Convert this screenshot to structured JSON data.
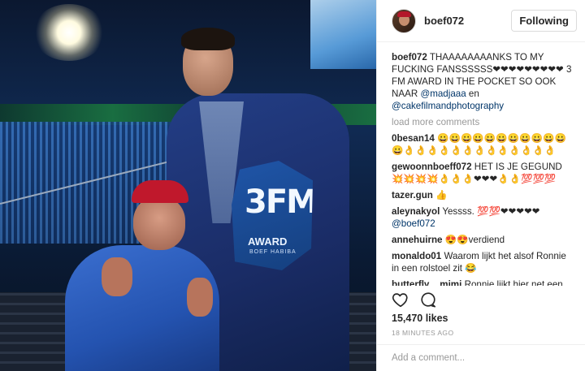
{
  "post": {
    "image_alt": "",
    "award": {
      "logo": "3FM",
      "word": "AWARD",
      "sub": "BOEF HABIBA"
    }
  },
  "header": {
    "username": "boef072",
    "follow_label": "Following"
  },
  "caption": {
    "user": "boef072",
    "text_1": "THAAAAAAAANKS TO MY FUCKING FANSSSSSS❤❤❤❤❤❤❤❤❤ 3 FM AWARD IN THE POCKET SO OOK NAAR ",
    "mention_1": "@madjaaa",
    "text_2": " en ",
    "mention_2": "@cakefilmandphotography"
  },
  "load_more": "load more comments",
  "comments": [
    {
      "user": "0besan14",
      "text": "😀😀😀😀😀😀😀😀😀😀😀😀👌👌👌👌👌👌👌👌👌👌👌👌👌"
    },
    {
      "user": "gewoonnboeff072",
      "text": "HET IS JE GEGUND 💥💥💥💥👌👌👌❤❤❤👌👌💯💯💯"
    },
    {
      "user": "tazer.gun",
      "text": "👍"
    },
    {
      "user": "aleynakyol",
      "text": "Yessss. 💯💯❤❤❤❤❤ ",
      "mention": "@boef072"
    },
    {
      "user": "annehuirne",
      "text": "😍😍verdiend"
    },
    {
      "user": "monaldo01",
      "text": "Waarom lijkt het alsof Ronnie in een rolstoel zit 😂"
    },
    {
      "user": "butterfly__mimi",
      "text": "Ronnie lijkt hier net een handi"
    }
  ],
  "actions": {
    "like_icon": "heart-outline-icon",
    "comment_icon": "comment-bubble-icon"
  },
  "likes": "15,470 likes",
  "timestamp": "18 MINUTES AGO",
  "add_comment": {
    "placeholder": "Add a comment..."
  }
}
